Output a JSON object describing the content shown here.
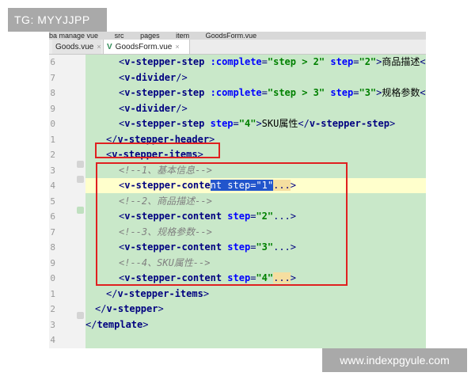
{
  "watermarks": {
    "top": "TG: MYYJJPP",
    "bottom": "www.indexpgyule.com"
  },
  "breadcrumb": [
    "ba manage vue",
    "src",
    "pages",
    "item",
    "GoodsForm.vue"
  ],
  "tabs": [
    {
      "label": "Goods.vue",
      "close": "×"
    },
    {
      "label": "GoodsForm.vue",
      "close": "×"
    }
  ],
  "line_numbers": [
    "6",
    "7",
    "8",
    "9",
    "0",
    "1",
    "2",
    "3",
    "4",
    "5",
    "6",
    "7",
    "8",
    "9",
    "0",
    "1",
    "2",
    "3",
    "4",
    "5"
  ],
  "code": {
    "l1": {
      "open": "<",
      "tag": "v-stepper-step",
      "attr1": " :complete",
      "eq1": "=",
      "str1": "\"step > 2\"",
      "attr2": " step",
      "eq2": "=",
      "str2": "\"2\"",
      "close": ">",
      "text": "商品描述",
      "end": "</"
    },
    "l2": {
      "open": "<",
      "tag": "v-divider",
      "close": "/>"
    },
    "l3": {
      "open": "<",
      "tag": "v-stepper-step",
      "attr1": " :complete",
      "eq1": "=",
      "str1": "\"step > 3\"",
      "attr2": " step",
      "eq2": "=",
      "str2": "\"3\"",
      "close": ">",
      "text": "规格参数",
      "end": "</"
    },
    "l4": {
      "open": "<",
      "tag": "v-divider",
      "close": "/>"
    },
    "l5": {
      "open": "<",
      "tag": "v-stepper-step",
      "attr": " step",
      "eq": "=",
      "str": "\"4\"",
      "close": ">",
      "text": "SKU属性",
      "end_open": "</",
      "end_tag": "v-stepper-step",
      "end_close": ">"
    },
    "l6": {
      "open": "</",
      "tag": "v-stepper-header",
      "close": ">"
    },
    "l7": {
      "open": "<",
      "tag": "v-stepper-items",
      "close": ">"
    },
    "l8": {
      "comment": "<!--1、基本信息-->"
    },
    "l9": {
      "open": "<",
      "tag_a": "v-stepper-conte",
      "tag_b": "nt",
      "attr": " step",
      "eq": "=",
      "str": "\"1\"",
      "dots": "...",
      "close": ">"
    },
    "l10": {
      "comment": "<!--2、商品描述-->"
    },
    "l11": {
      "open": "<",
      "tag": "v-stepper-content",
      "attr": " step",
      "eq": "=",
      "str": "\"2\"",
      "dots": "...",
      "close": ">"
    },
    "l12": {
      "comment": "<!--3、规格参数-->"
    },
    "l13": {
      "open": "<",
      "tag": "v-stepper-content",
      "attr": " step",
      "eq": "=",
      "str": "\"3\"",
      "dots": "...",
      "close": ">"
    },
    "l14": {
      "comment": "<!--4、SKU属性-->"
    },
    "l15": {
      "open": "<",
      "tag": "v-stepper-content",
      "attr": " step",
      "eq": "=",
      "str": "\"4\"",
      "dots": "...",
      "close": ">"
    },
    "l16": {
      "open": "</",
      "tag": "v-stepper-items",
      "close": ">"
    },
    "l17": {
      "open": "</",
      "tag": "v-stepper",
      "close": ">"
    },
    "l18": {
      "open": "</",
      "tag": "template",
      "close": ">"
    }
  },
  "colors": {
    "code_bg": "#c9e8c9",
    "annotation_red": "#e02020",
    "selection": "#2255cc"
  }
}
